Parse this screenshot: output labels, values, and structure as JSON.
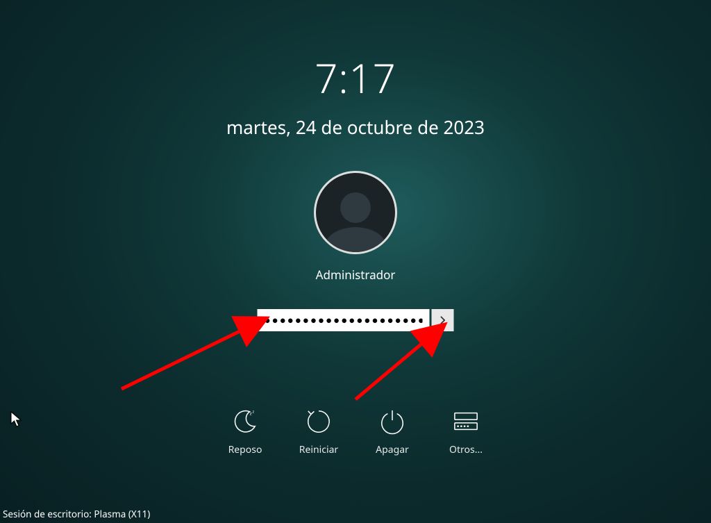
{
  "clock": {
    "time": "7:17",
    "date": "martes, 24 de octubre de 2023"
  },
  "user": {
    "name": "Administrador"
  },
  "password": {
    "value": "●●●●●●●●●●●●●●●●●●●●●●●●●"
  },
  "actions": {
    "sleep": {
      "label": "Reposo"
    },
    "restart": {
      "label": "Reiniciar"
    },
    "shutdown": {
      "label": "Apagar"
    },
    "other": {
      "label": "Otros..."
    }
  },
  "session": {
    "label": "Sesión de escritorio: Plasma (X11)"
  },
  "annotations": {
    "arrow_color": "#ff0000"
  }
}
